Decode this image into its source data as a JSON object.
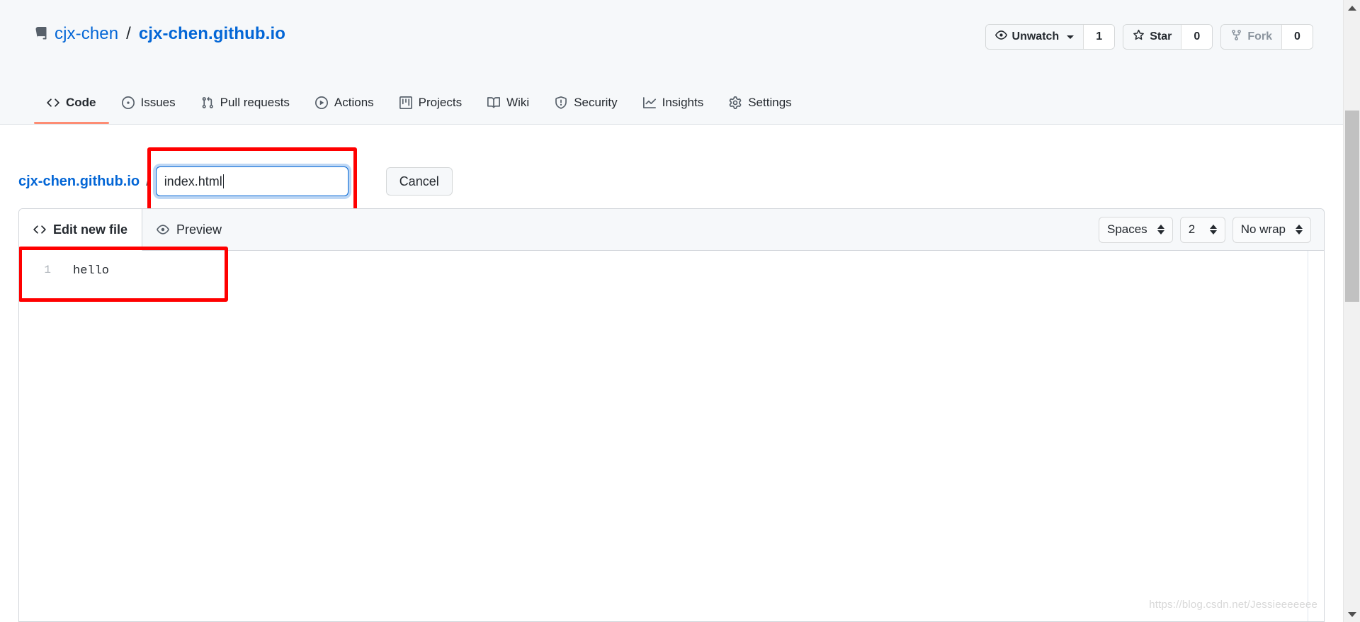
{
  "repo": {
    "icon": "repo-icon",
    "owner": "cjx-chen",
    "separator": "/",
    "name": "cjx-chen.github.io"
  },
  "actions": [
    {
      "icon": "eye-icon",
      "label": "Unwatch",
      "count": "1",
      "has_caret": true,
      "muted": false
    },
    {
      "icon": "star-icon",
      "label": "Star",
      "count": "0",
      "has_caret": false,
      "muted": false
    },
    {
      "icon": "fork-icon",
      "label": "Fork",
      "count": "0",
      "has_caret": false,
      "muted": true
    }
  ],
  "nav": {
    "tabs": [
      {
        "icon": "code-icon",
        "label": "Code",
        "active": true
      },
      {
        "icon": "issue-opened-icon",
        "label": "Issues",
        "active": false
      },
      {
        "icon": "git-pull-request-icon",
        "label": "Pull requests",
        "active": false
      },
      {
        "icon": "play-icon",
        "label": "Actions",
        "active": false
      },
      {
        "icon": "project-icon",
        "label": "Projects",
        "active": false
      },
      {
        "icon": "book-icon",
        "label": "Wiki",
        "active": false
      },
      {
        "icon": "shield-icon",
        "label": "Security",
        "active": false
      },
      {
        "icon": "graph-icon",
        "label": "Insights",
        "active": false
      },
      {
        "icon": "gear-icon",
        "label": "Settings",
        "active": false
      }
    ],
    "active_underline_color": "#fd8c73"
  },
  "file_path": {
    "repo_link": "cjx-chen.github.io",
    "separator": "/",
    "filename_value": "index.html",
    "filename_placeholder": "Name your file...",
    "cancel_label": "Cancel",
    "focus_color": "#0366d6",
    "annotation_color": "#ff0000"
  },
  "editor": {
    "tabs": [
      {
        "icon": "code-icon",
        "label": "Edit new file",
        "active": true
      },
      {
        "icon": "eye-icon",
        "label": "Preview",
        "active": false
      }
    ],
    "options": [
      {
        "name": "indent-mode-select",
        "value": "Spaces"
      },
      {
        "name": "indent-width-select",
        "value": "2"
      },
      {
        "name": "line-wrap-select",
        "value": "No wrap"
      }
    ],
    "lines": [
      {
        "number": "1",
        "text": "hello"
      }
    ]
  },
  "watermark": {
    "text": "https://blog.csdn.net/Jessieeeeeee"
  }
}
